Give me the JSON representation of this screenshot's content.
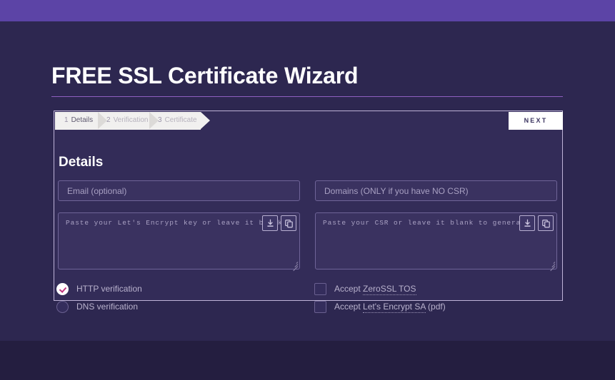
{
  "theme": {
    "topbar_color": "#5c44a6",
    "page_background": "#2d2750",
    "footer_color": "#241e40",
    "card_background": "#332c58",
    "card_border": "#bfb4d8",
    "accent_check": "#c0357e",
    "rule_color": "#8f5fc0"
  },
  "header": {
    "title": "FREE SSL Certificate Wizard"
  },
  "wizard": {
    "steps": [
      {
        "number": "1",
        "label": "Details",
        "state": "active"
      },
      {
        "number": "2",
        "label": "Verification",
        "state": "inactive"
      },
      {
        "number": "3",
        "label": "Certificate",
        "state": "inactive"
      }
    ],
    "next_label": "NEXT",
    "panel_heading": "Details"
  },
  "form": {
    "email": {
      "value": "",
      "placeholder": "Email (optional)"
    },
    "domains": {
      "value": "",
      "placeholder": "Domains (ONLY if you have NO CSR)"
    },
    "key_textarea": {
      "value": "",
      "placeholder": "Paste your Let's Encrypt key or leave it blank to generate.",
      "download_icon": "download-icon",
      "copy_icon": "copy-icon"
    },
    "csr_textarea": {
      "value": "",
      "placeholder": "Paste your CSR or leave it blank to generate.",
      "download_icon": "download-icon",
      "copy_icon": "copy-icon"
    },
    "verification_options": [
      {
        "label": "HTTP verification",
        "selected": true
      },
      {
        "label": "DNS verification",
        "selected": false
      }
    ],
    "agreements": [
      {
        "label_prefix": "Accept ",
        "link_text": "ZeroSSL TOS",
        "label_suffix": "",
        "checked": false
      },
      {
        "label_prefix": "Accept ",
        "link_text": "Let's Encrypt SA",
        "label_suffix": " (pdf)",
        "checked": false
      }
    ]
  }
}
